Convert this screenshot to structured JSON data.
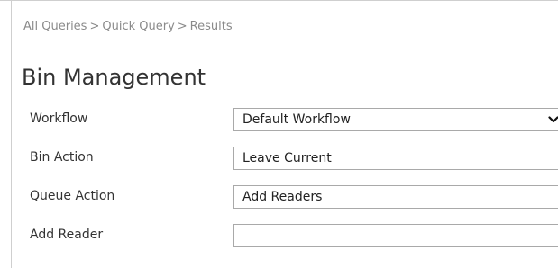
{
  "breadcrumb": {
    "items": [
      "All Queries",
      "Quick Query",
      "Results"
    ],
    "separator": ">"
  },
  "page": {
    "title": "Bin Management"
  },
  "form": {
    "workflow": {
      "label": "Workflow",
      "value": "Default Workflow"
    },
    "bin_action": {
      "label": "Bin Action",
      "value": "Leave Current"
    },
    "queue_action": {
      "label": "Queue Action",
      "value": "Add Readers"
    },
    "add_reader": {
      "label": "Add Reader",
      "value": ""
    }
  },
  "icons": {
    "workflow_dropdown": "chevron-down-icon"
  }
}
